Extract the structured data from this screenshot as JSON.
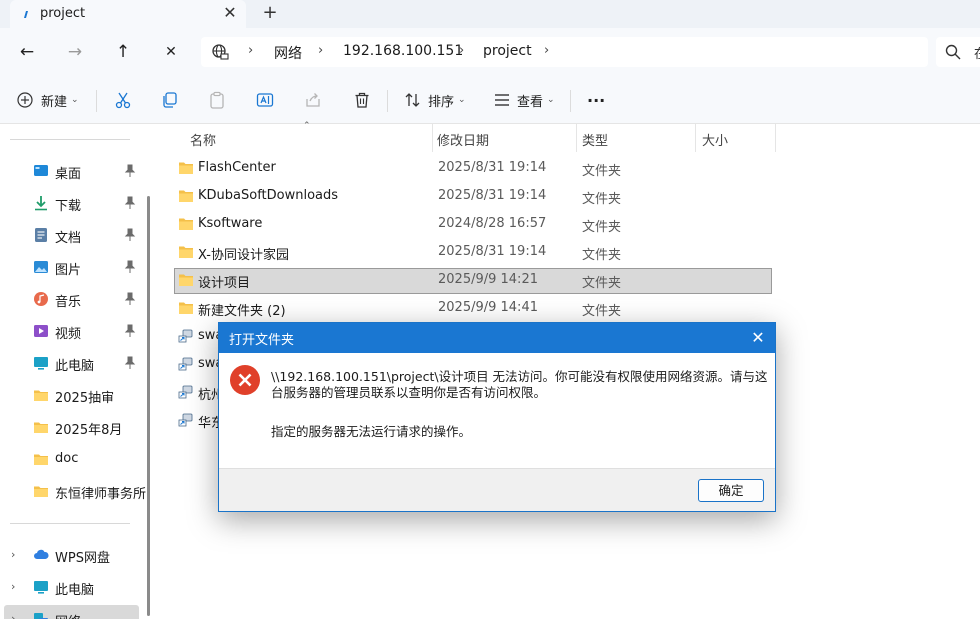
{
  "tab": {
    "title": "project",
    "close": "✕",
    "new": "+"
  },
  "nav": {
    "back": "←",
    "forward": "→",
    "up": "↑",
    "close": "✕"
  },
  "address": {
    "separators": [
      "›",
      "›",
      "›",
      "›"
    ],
    "crumbs": [
      "网络",
      "192.168.100.151",
      "project"
    ]
  },
  "search": {
    "text": "在"
  },
  "toolbar": {
    "new_label": "新建",
    "sort_label": "排序",
    "view_label": "查看",
    "more": "···",
    "caret": "⌄"
  },
  "sidebar": {
    "pinned": [
      {
        "label": "桌面"
      },
      {
        "label": "下载"
      },
      {
        "label": "文档"
      },
      {
        "label": "图片"
      },
      {
        "label": "音乐"
      },
      {
        "label": "视频"
      },
      {
        "label": "此电脑"
      }
    ],
    "folders": [
      {
        "label": "2025抽审"
      },
      {
        "label": "2025年8月"
      },
      {
        "label": "doc"
      },
      {
        "label": "东恒律师事务所"
      }
    ],
    "tree": [
      {
        "label": "WPS网盘"
      },
      {
        "label": "此电脑"
      },
      {
        "label": "网络"
      }
    ],
    "chevron": "›"
  },
  "columns": {
    "name": "名称",
    "date": "修改日期",
    "type": "类型",
    "size": "大小",
    "sort_indicator": "⌃"
  },
  "files": [
    {
      "name": "FlashCenter",
      "date": "2025/8/31 19:14",
      "type": "文件夹",
      "kind": "folder"
    },
    {
      "name": "KDubaSoftDownloads",
      "date": "2025/8/31 19:14",
      "type": "文件夹",
      "kind": "folder"
    },
    {
      "name": "Ksoftware",
      "date": "2024/8/28 16:57",
      "type": "文件夹",
      "kind": "folder"
    },
    {
      "name": "X-协同设计家园",
      "date": "2025/8/31 19:14",
      "type": "文件夹",
      "kind": "folder"
    },
    {
      "name": "设计项目",
      "date": "2025/9/9 14:21",
      "type": "文件夹",
      "kind": "folder"
    },
    {
      "name": "新建文件夹 (2)",
      "date": "2025/9/9 14:41",
      "type": "文件夹",
      "kind": "folder"
    },
    {
      "name": "swa",
      "date": "",
      "type": "",
      "kind": "shortcut"
    },
    {
      "name": "swa",
      "date": "",
      "type": "",
      "kind": "shortcut"
    },
    {
      "name": "杭州",
      "date": "",
      "type": "",
      "kind": "shortcut"
    },
    {
      "name": "华东",
      "date": "",
      "type": "",
      "kind": "shortcut"
    }
  ],
  "dialog": {
    "title": "打开文件夹",
    "close": "✕",
    "message": "\\\\192.168.100.151\\project\\设计项目 无法访问。你可能没有权限使用网络资源。请与这台服务器的管理员联系以查明你是否有访问权限。",
    "detail": "指定的服务器无法运行请求的操作。",
    "ok_label": "确定"
  },
  "colors": {
    "accent": "#1a77d2",
    "error": "#e0402a",
    "folder": "#f4c04a"
  }
}
